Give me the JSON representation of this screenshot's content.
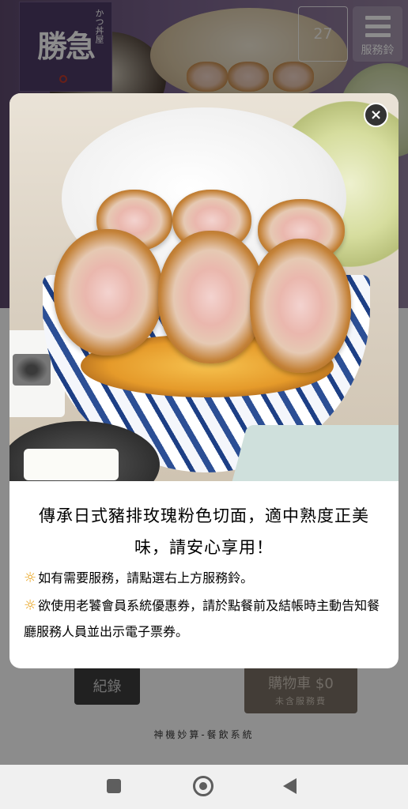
{
  "header": {
    "logo_main": "勝急",
    "logo_sub": "かつ丼屋",
    "table_number": "27",
    "service_bell_label": "服務鈴"
  },
  "modal": {
    "close_label": "×",
    "headline": "傳承日式豬排玫瑰粉色切面，適中熟度正美味，請安心享用！",
    "notes": [
      "如有需要服務，請點選右上方服務鈴。",
      "欲使用老饕會員系統優惠券，請於點餐前及結帳時主動告知餐廳服務人員並出示電子票券。"
    ],
    "note_icon": "sun-icon"
  },
  "footer": {
    "record_label": "紀錄",
    "cart_label": "購物車 $0",
    "cart_note": "未含服務費",
    "brand": "神機妙算-餐飲系統"
  },
  "colors": {
    "logo_bg": "#4e3b67",
    "note_icon": "#e8a21a",
    "cart_bg": "#7a7065",
    "record_bg": "#3d3d3d"
  }
}
